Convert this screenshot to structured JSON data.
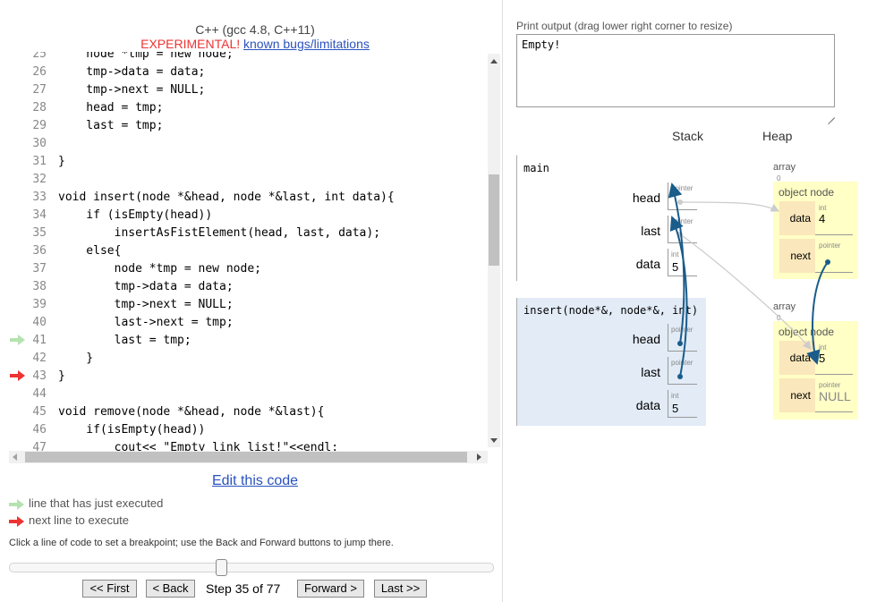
{
  "header": {
    "language": "C++ (gcc 4.8, C++11)",
    "experimental": "EXPERIMENTAL!",
    "bugs_link": "known bugs/limitations"
  },
  "code": {
    "lines": [
      {
        "n": "25",
        "text": "    node *tmp = new node;"
      },
      {
        "n": "26",
        "text": "    tmp->data = data;"
      },
      {
        "n": "27",
        "text": "    tmp->next = NULL;"
      },
      {
        "n": "28",
        "text": "    head = tmp;"
      },
      {
        "n": "29",
        "text": "    last = tmp;"
      },
      {
        "n": "30",
        "text": ""
      },
      {
        "n": "31",
        "text": "}"
      },
      {
        "n": "32",
        "text": ""
      },
      {
        "n": "33",
        "text": "void insert(node *&head, node *&last, int data){"
      },
      {
        "n": "34",
        "text": "    if (isEmpty(head))"
      },
      {
        "n": "35",
        "text": "        insertAsFistElement(head, last, data);"
      },
      {
        "n": "36",
        "text": "    else{"
      },
      {
        "n": "37",
        "text": "        node *tmp = new node;"
      },
      {
        "n": "38",
        "text": "        tmp->data = data;"
      },
      {
        "n": "39",
        "text": "        tmp->next = NULL;"
      },
      {
        "n": "40",
        "text": "        last->next = tmp;"
      },
      {
        "n": "41",
        "text": "        last = tmp;"
      },
      {
        "n": "42",
        "text": "    }"
      },
      {
        "n": "43",
        "text": "}"
      },
      {
        "n": "44",
        "text": ""
      },
      {
        "n": "45",
        "text": "void remove(node *&head, node *&last){"
      },
      {
        "n": "46",
        "text": "    if(isEmpty(head))"
      },
      {
        "n": "47",
        "text": "        cout<< \"Empty link list!\"<<endl;"
      }
    ],
    "just_executed_line": "41",
    "next_line": "43"
  },
  "edit_link": "Edit this code",
  "legend": {
    "green": "line that has just executed",
    "red": "next line to execute"
  },
  "breakpoint_hint": "Click a line of code to set a breakpoint; use the Back and Forward buttons to jump there.",
  "navigation": {
    "first": "<< First",
    "back": "< Back",
    "step_label": "Step 35 of 77",
    "forward": "Forward >",
    "last": "Last >>",
    "current_step": 35,
    "total_steps": 77
  },
  "output": {
    "label": "Print output (drag lower right corner to resize)",
    "text": "Empty!"
  },
  "viz": {
    "stack_header": "Stack",
    "heap_header": "Heap",
    "frames": [
      {
        "name": "main",
        "vars": [
          {
            "name": "head",
            "type": "pointer",
            "value": ""
          },
          {
            "name": "last",
            "type": "pointer",
            "value": ""
          },
          {
            "name": "data",
            "type": "int",
            "value": "5"
          }
        ]
      },
      {
        "name": "insert(node*&, node*&, int)",
        "vars": [
          {
            "name": "head",
            "type": "pointer",
            "value": ""
          },
          {
            "name": "last",
            "type": "pointer",
            "value": ""
          },
          {
            "name": "data",
            "type": "int",
            "value": "5"
          }
        ]
      }
    ],
    "heap": [
      {
        "label": "array",
        "index": "0",
        "title": "object node",
        "fields": [
          {
            "name": "data",
            "type": "int",
            "value": "4"
          },
          {
            "name": "next",
            "type": "pointer",
            "value": ""
          }
        ]
      },
      {
        "label": "array",
        "index": "0",
        "title": "object node",
        "fields": [
          {
            "name": "data",
            "type": "int",
            "value": "5"
          },
          {
            "name": "next",
            "type": "pointer",
            "value": "NULL"
          }
        ]
      }
    ]
  },
  "colors": {
    "accent_link": "#2a52be",
    "arrow_green": "#b5e3b0",
    "arrow_red": "#e33333",
    "pointer_dark": "#1a5c8a",
    "pointer_light": "#cccccc",
    "frame_active_bg": "#e2ebf6",
    "heap_bg": "#ffffc6",
    "field_bg": "#fae7bb"
  }
}
